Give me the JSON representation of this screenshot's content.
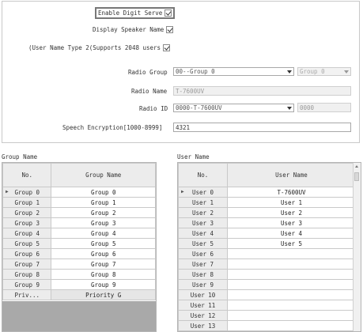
{
  "settings": {
    "enable_digit_serve": {
      "label": "Enable Digit Serve",
      "checked": true
    },
    "display_speaker_name": {
      "label": "Display Speaker Name",
      "checked": true
    },
    "user_name_type2": {
      "label": "(User Name Type 2(Supports 2048 users",
      "checked": true
    },
    "radio_group": {
      "label": "Radio Group",
      "value": "00--Group 0",
      "secondary_value": "Group 0"
    },
    "radio_name": {
      "label": "Radio Name",
      "value": "T-7600UV"
    },
    "radio_id": {
      "label": "Radio ID",
      "value": "0000-T-7600UV",
      "secondary_value": "0000"
    },
    "speech_encryption": {
      "label": "Speech Encryption[1000-8999]",
      "value": "4321"
    }
  },
  "group_table": {
    "title": "Group Name",
    "columns": [
      "No.",
      "Group Name"
    ],
    "rows": [
      {
        "no": "Group 0",
        "name": "Group 0"
      },
      {
        "no": "Group 1",
        "name": "Group 1"
      },
      {
        "no": "Group 2",
        "name": "Group 2"
      },
      {
        "no": "Group 3",
        "name": "Group 3"
      },
      {
        "no": "Group 4",
        "name": "Group 4"
      },
      {
        "no": "Group 5",
        "name": "Group 5"
      },
      {
        "no": "Group 6",
        "name": "Group 6"
      },
      {
        "no": "Group 7",
        "name": "Group 7"
      },
      {
        "no": "Group 8",
        "name": "Group 8"
      },
      {
        "no": "Group 9",
        "name": "Group 9"
      },
      {
        "no": "Priv...",
        "name": "Priority G"
      }
    ]
  },
  "user_table": {
    "title": "User Name",
    "columns": [
      "No.",
      "User Name"
    ],
    "rows": [
      {
        "no": "User 0",
        "name": "T-7600UV"
      },
      {
        "no": "User 1",
        "name": "User 1"
      },
      {
        "no": "User 2",
        "name": "User 2"
      },
      {
        "no": "User 3",
        "name": "User 3"
      },
      {
        "no": "User 4",
        "name": "User 4"
      },
      {
        "no": "User 5",
        "name": "User 5"
      },
      {
        "no": "User 6",
        "name": ""
      },
      {
        "no": "User 7",
        "name": ""
      },
      {
        "no": "User 8",
        "name": ""
      },
      {
        "no": "User 9",
        "name": ""
      },
      {
        "no": "User 10",
        "name": ""
      },
      {
        "no": "User 11",
        "name": ""
      },
      {
        "no": "User 12",
        "name": ""
      },
      {
        "no": "User 13",
        "name": ""
      }
    ]
  },
  "icons": {
    "row_pointer": "triangle-right-icon",
    "dropdown": "chevron-down-icon",
    "scroll_up": "arrow-up-icon"
  }
}
